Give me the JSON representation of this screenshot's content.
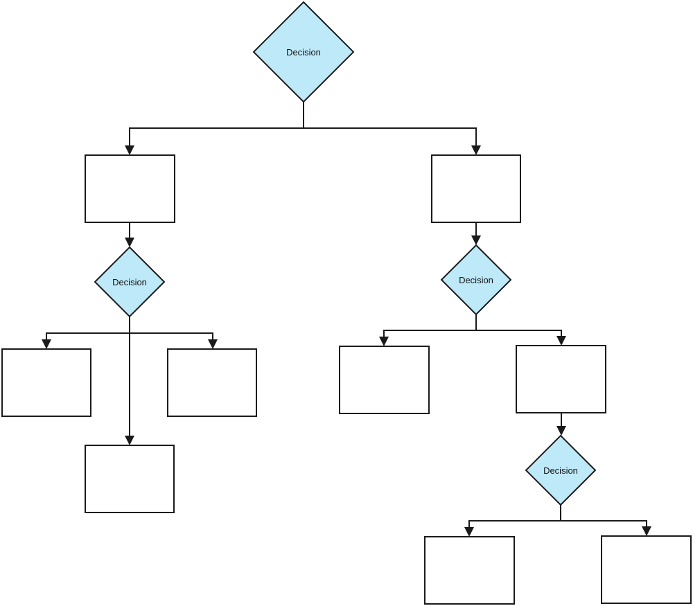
{
  "diagram": {
    "type": "flowchart",
    "colors": {
      "stroke": "#1a1a1a",
      "decision_fill": "#bde9f9",
      "process_fill": "#ffffff",
      "background": "#ffffff"
    },
    "nodes": [
      {
        "id": "d1",
        "kind": "decision",
        "label": "Decision"
      },
      {
        "id": "p1",
        "kind": "process",
        "label": ""
      },
      {
        "id": "p2",
        "kind": "process",
        "label": ""
      },
      {
        "id": "d2",
        "kind": "decision",
        "label": "Decision"
      },
      {
        "id": "d3",
        "kind": "decision",
        "label": "Decision"
      },
      {
        "id": "p3",
        "kind": "process",
        "label": ""
      },
      {
        "id": "p4",
        "kind": "process",
        "label": ""
      },
      {
        "id": "p5",
        "kind": "process",
        "label": ""
      },
      {
        "id": "p6",
        "kind": "process",
        "label": ""
      },
      {
        "id": "p7",
        "kind": "process",
        "label": ""
      },
      {
        "id": "d4",
        "kind": "decision",
        "label": "Decision"
      },
      {
        "id": "p8",
        "kind": "process",
        "label": ""
      },
      {
        "id": "p9",
        "kind": "process",
        "label": ""
      }
    ],
    "edges": [
      {
        "from": "d1",
        "to": "p1"
      },
      {
        "from": "d1",
        "to": "p2"
      },
      {
        "from": "p1",
        "to": "d2"
      },
      {
        "from": "p2",
        "to": "d3"
      },
      {
        "from": "d2",
        "to": "p3"
      },
      {
        "from": "d2",
        "to": "p4"
      },
      {
        "from": "d2",
        "to": "p5"
      },
      {
        "from": "d3",
        "to": "p6"
      },
      {
        "from": "d3",
        "to": "p7"
      },
      {
        "from": "p7",
        "to": "d4"
      },
      {
        "from": "d4",
        "to": "p8"
      },
      {
        "from": "d4",
        "to": "p9"
      }
    ]
  }
}
